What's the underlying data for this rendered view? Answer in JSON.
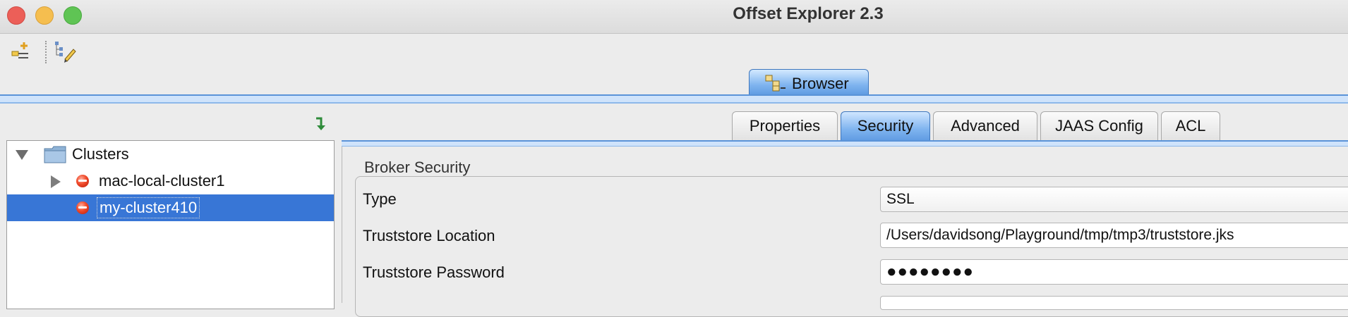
{
  "window": {
    "title": "Offset Explorer  2.3"
  },
  "toolbar": {
    "buttons": [
      {
        "icon": "add-cluster-icon"
      },
      {
        "icon": "edit-tree-icon"
      }
    ]
  },
  "main_tab": {
    "label": "Browser",
    "icon": "browser-tree-icon"
  },
  "tree": {
    "root": {
      "label": "Clusters",
      "icon": "folder-icon",
      "expanded": true
    },
    "items": [
      {
        "label": "mac-local-cluster1",
        "icon": "cluster-disconnected-icon",
        "selected": false,
        "expandable": true
      },
      {
        "label": "my-cluster410",
        "icon": "cluster-disconnected-icon",
        "selected": true,
        "expandable": false
      }
    ]
  },
  "tabs": [
    {
      "label": "Properties",
      "active": false
    },
    {
      "label": "Security",
      "active": true
    },
    {
      "label": "Advanced",
      "active": false
    },
    {
      "label": "JAAS Config",
      "active": false
    },
    {
      "label": "ACL",
      "active": false
    }
  ],
  "security": {
    "group_title": "Broker Security",
    "fields": [
      {
        "label": "Type",
        "value": "SSL",
        "kind": "select"
      },
      {
        "label": "Truststore Location",
        "value": "/Users/davidsong/Playground/tmp/tmp3/truststore.jks",
        "kind": "text"
      },
      {
        "label": "Truststore Password",
        "value": "●●●●●●●●",
        "kind": "password"
      }
    ]
  },
  "colors": {
    "accent": "#3876d6",
    "tab_active": "#7fb4ef",
    "close": "#ec5f58",
    "minimize": "#f5be4f",
    "maximize": "#5fc454"
  }
}
